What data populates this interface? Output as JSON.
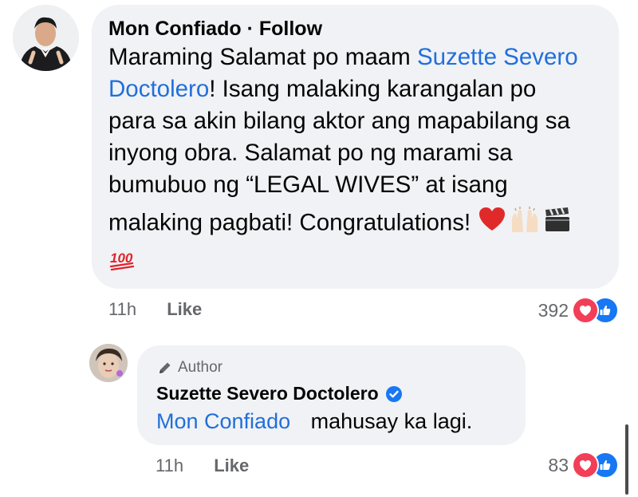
{
  "comment": {
    "author_name": "Mon Confiado",
    "follow_label": "· Follow",
    "text_lines": [
      [
        "Maraming Salamat po maam ",
        "Suzette Severo"
      ],
      [
        "Doctolero",
        "! Isang malaking karangalan po"
      ],
      "para sa akin bilang aktor ang mapabilang sa",
      "inyong obra. Salamat po ng marami sa",
      "bumubuo ng “LEGAL WIVES” at isang",
      "malaking pagbati! Congratulations!"
    ],
    "emojis": [
      "red-heart",
      "raising-hands",
      "clapper-board",
      "hundred-points"
    ],
    "hundred_label": "100",
    "time": "11h",
    "like_label": "Like",
    "reaction_count": "392"
  },
  "reply": {
    "badge_label": "Author",
    "author_name": "Suzette Severo Doctolero",
    "mention": "Mon Confiado",
    "text": "mahusay ka lagi.",
    "time": "11h",
    "like_label": "Like",
    "reaction_count": "83"
  },
  "colors": {
    "mention": "#216fdb",
    "bubble": "#f0f2f5",
    "love": "#f33e58",
    "like": "#1877f2",
    "verified": "#1877f2"
  }
}
